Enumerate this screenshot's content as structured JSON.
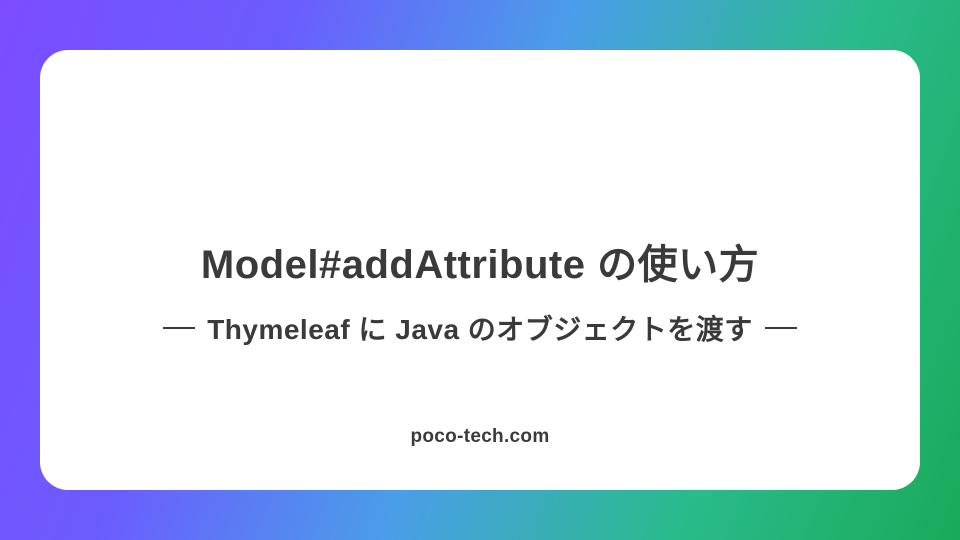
{
  "card": {
    "title": "Model#addAttribute の使い方",
    "subtitle": "Thymeleaf に Java のオブジェクトを渡す",
    "domain": "poco-tech.com"
  }
}
